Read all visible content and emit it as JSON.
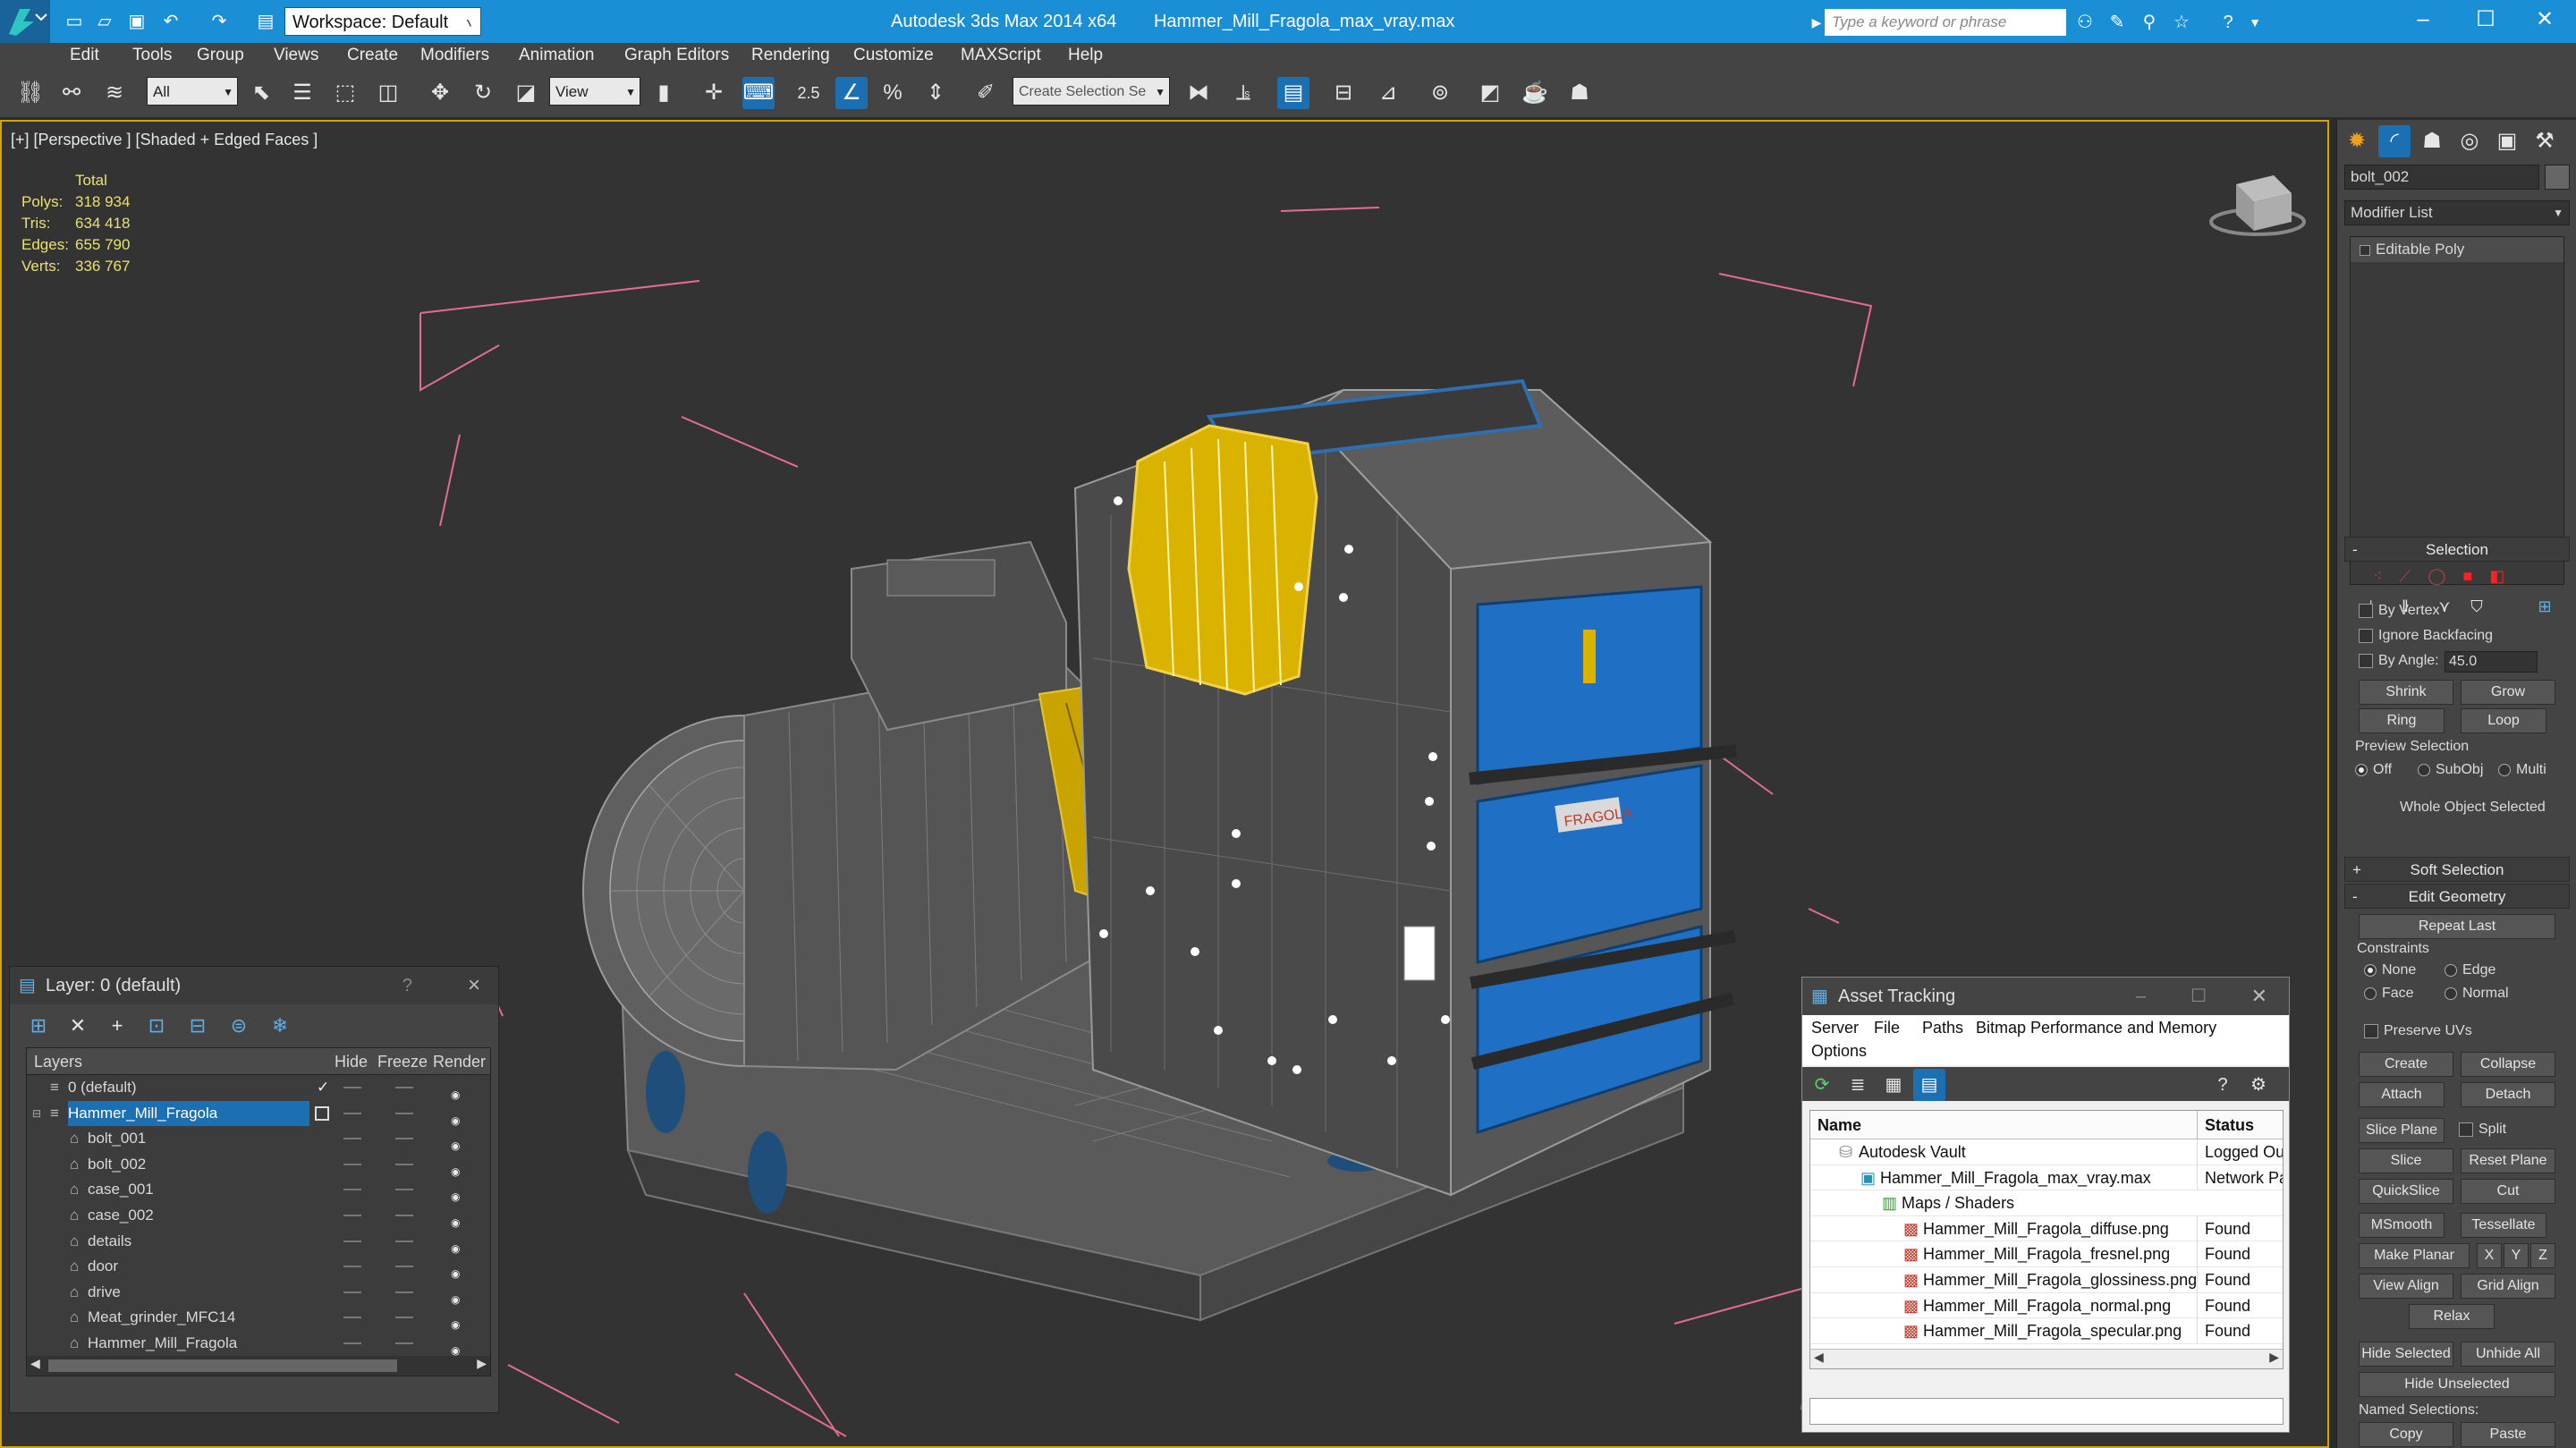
{
  "app": {
    "title": "Autodesk 3ds Max  2014 x64",
    "file": "Hammer_Mill_Fragola_max_vray.max",
    "workspace": "Workspace: Default",
    "search_placeholder": "Type a keyword or phrase"
  },
  "menu": [
    "Edit",
    "Tools",
    "Group",
    "Views",
    "Create",
    "Modifiers",
    "Animation",
    "Graph Editors",
    "Rendering",
    "Customize",
    "MAXScript",
    "Help"
  ],
  "toolbar": {
    "filter": "All",
    "refcoord": "View",
    "snap_label": "2.5",
    "selection_set_placeholder": "Create Selection Se"
  },
  "viewport": {
    "label": "[+] [Perspective ] [Shaded + Edged Faces ]",
    "stats_header": "Total",
    "stats": [
      {
        "k": "Polys:",
        "v": "318 934"
      },
      {
        "k": "Tris:",
        "v": "634 418"
      },
      {
        "k": "Edges:",
        "v": "655 790"
      },
      {
        "k": "Verts:",
        "v": "336 767"
      }
    ],
    "logo": "FRAGOLA"
  },
  "layer_panel": {
    "title": "Layer: 0 (default)",
    "help": "?",
    "close": "×",
    "columns": {
      "name": "Layers",
      "hide": "Hide",
      "freeze": "Freeze",
      "render": "Render"
    },
    "rows": [
      {
        "name": "0 (default)",
        "indent": 0,
        "check": "✓"
      },
      {
        "name": "Hammer_Mill_Fragola",
        "indent": 0,
        "selected": true
      },
      {
        "name": "bolt_001",
        "indent": 1
      },
      {
        "name": "bolt_002",
        "indent": 1
      },
      {
        "name": "case_001",
        "indent": 1
      },
      {
        "name": "case_002",
        "indent": 1
      },
      {
        "name": "details",
        "indent": 1
      },
      {
        "name": "door",
        "indent": 1
      },
      {
        "name": "drive",
        "indent": 1
      },
      {
        "name": "Meat_grinder_MFC14",
        "indent": 1
      },
      {
        "name": "Hammer_Mill_Fragola",
        "indent": 1
      }
    ]
  },
  "asset_panel": {
    "title": "Asset Tracking",
    "menu": [
      "Server",
      "File",
      "Paths",
      "Bitmap Performance and Memory",
      "Options"
    ],
    "columns": {
      "name": "Name",
      "status": "Status"
    },
    "rows": [
      {
        "name": "Autodesk Vault",
        "status": "Logged Ou",
        "indent": 1
      },
      {
        "name": "Hammer_Mill_Fragola_max_vray.max",
        "status": "Network Pa",
        "indent": 2
      },
      {
        "name": "Maps / Shaders",
        "status": "",
        "indent": 3
      },
      {
        "name": "Hammer_Mill_Fragola_diffuse.png",
        "status": "Found",
        "indent": 4
      },
      {
        "name": "Hammer_Mill_Fragola_fresnel.png",
        "status": "Found",
        "indent": 4
      },
      {
        "name": "Hammer_Mill_Fragola_glossiness.png",
        "status": "Found",
        "indent": 4
      },
      {
        "name": "Hammer_Mill_Fragola_normal.png",
        "status": "Found",
        "indent": 4
      },
      {
        "name": "Hammer_Mill_Fragola_specular.png",
        "status": "Found",
        "indent": 4
      }
    ]
  },
  "cmd_panel": {
    "object_name": "bolt_002",
    "modifier_list": "Modifier List",
    "stack_item": "Editable Poly",
    "selection": {
      "header": "Selection",
      "by_vertex": "By Vertex",
      "ignore_backfacing": "Ignore Backfacing",
      "by_angle": "By Angle:",
      "angle_value": "45.0",
      "shrink": "Shrink",
      "grow": "Grow",
      "ring": "Ring",
      "loop": "Loop",
      "preview": "Preview Selection",
      "off": "Off",
      "subobj": "SubObj",
      "multi": "Multi",
      "status": "Whole Object Selected"
    },
    "soft_selection": "Soft Selection",
    "edit_geometry": {
      "header": "Edit Geometry",
      "repeat_last": "Repeat Last",
      "constraints": "Constraints",
      "none": "None",
      "edge": "Edge",
      "face": "Face",
      "normal": "Normal",
      "preserve_uvs": "Preserve UVs",
      "create": "Create",
      "collapse": "Collapse",
      "attach": "Attach",
      "detach": "Detach",
      "slice_plane": "Slice Plane",
      "split": "Split",
      "slice": "Slice",
      "reset_plane": "Reset Plane",
      "quickslice": "QuickSlice",
      "cut": "Cut",
      "msmooth": "MSmooth",
      "tessellate": "Tessellate",
      "make_planar": "Make Planar",
      "x": "X",
      "y": "Y",
      "z": "Z",
      "view_align": "View Align",
      "grid_align": "Grid Align",
      "relax": "Relax",
      "hide_selected": "Hide Selected",
      "unhide_all": "Unhide All",
      "hide_unselected": "Hide Unselected",
      "named_selections": "Named Selections:",
      "copy": "Copy",
      "paste": "Paste"
    }
  }
}
